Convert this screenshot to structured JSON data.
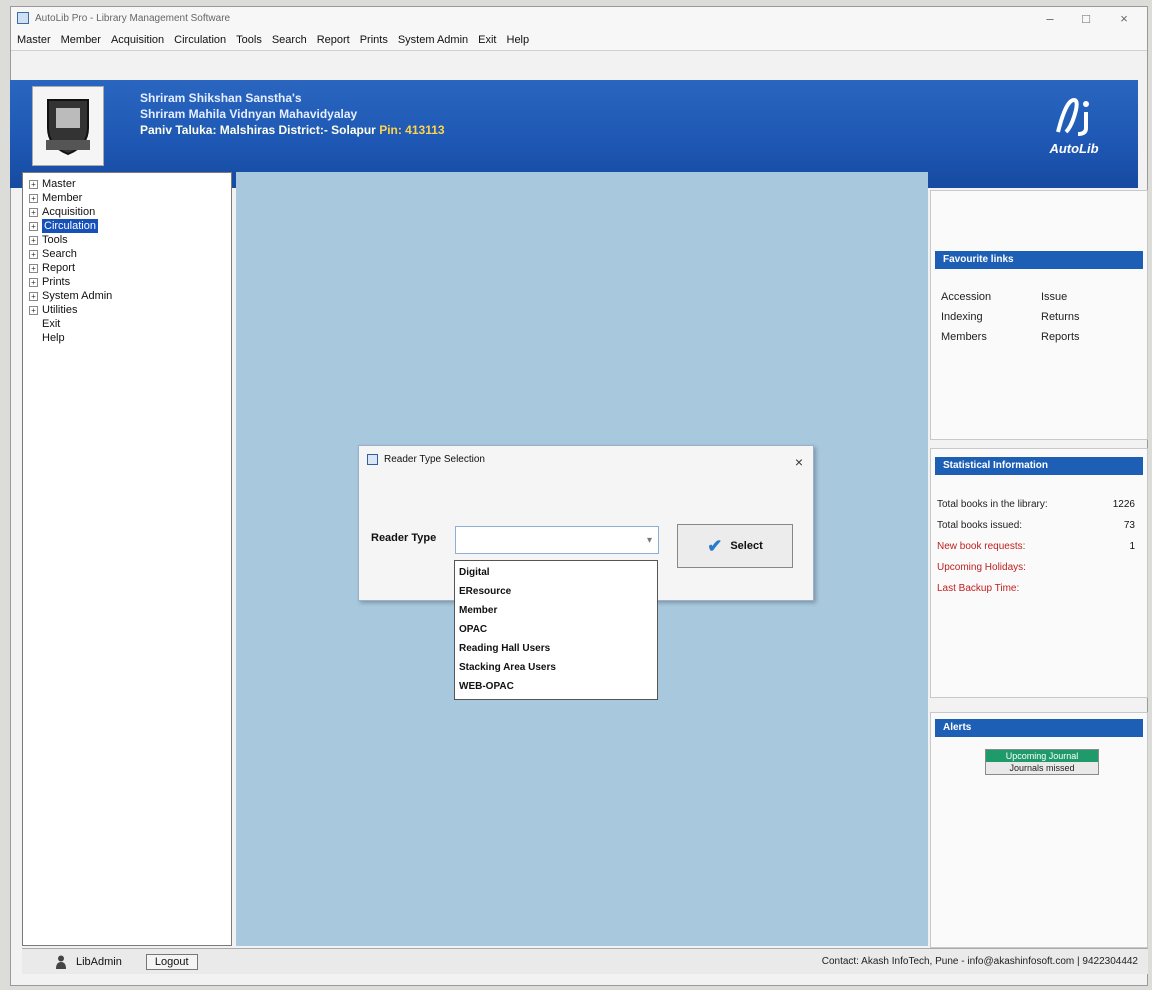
{
  "window": {
    "title": "AutoLib Pro - Library Management Software",
    "controls": [
      "–",
      "□",
      "×"
    ]
  },
  "menubar": {
    "items": [
      "Master",
      "Member",
      "Acquisition",
      "Circulation",
      "Tools",
      "Search",
      "Report",
      "Prints",
      "System Admin",
      "Exit",
      "Help"
    ]
  },
  "banner": {
    "line1": "Shriram Shikshan Sanstha's",
    "line2": "Shriram Mahila Vidnyan Mahavidyalay",
    "line3": "Paniv Taluka: Malshiras  District:- Solapur",
    "pin": "Pin: 413113",
    "brand_text": "AutoLib",
    "brand_color": "#1d57b3"
  },
  "sidebar": {
    "items": [
      {
        "label": "Master",
        "expandable": true
      },
      {
        "label": "Member",
        "expandable": true
      },
      {
        "label": "Acquisition",
        "expandable": true
      },
      {
        "label": "Circulation",
        "expandable": true,
        "selected": true
      },
      {
        "label": "Tools",
        "expandable": true
      },
      {
        "label": "Search",
        "expandable": true
      },
      {
        "label": "Report",
        "expandable": true
      },
      {
        "label": "Prints",
        "expandable": true
      },
      {
        "label": "System Admin",
        "expandable": true
      },
      {
        "label": "Utilities",
        "expandable": true
      },
      {
        "label": "Exit",
        "expandable": false
      },
      {
        "label": "Help",
        "expandable": false
      }
    ]
  },
  "favorites": {
    "header": "Favourite links",
    "links": [
      "Accession",
      "Issue",
      "Indexing",
      "Returns",
      "Members",
      "Reports"
    ]
  },
  "statistics": {
    "header": "Statistical Information",
    "rows": [
      {
        "label": "Total books in the library:",
        "value": "1226",
        "red": false
      },
      {
        "label": "Total books issued:",
        "value": "73",
        "red": false
      },
      {
        "label": "New book requests:",
        "value": "1",
        "red": true
      },
      {
        "label": "Upcoming Holidays:",
        "value": "",
        "red": true
      },
      {
        "label": "Last Backup Time:",
        "value": "",
        "red": true
      }
    ]
  },
  "alerts": {
    "header": "Alerts",
    "tab_active": "Upcoming Journal",
    "tab_inactive": "Journals missed"
  },
  "dialog": {
    "title": "Reader Type Selection",
    "close": "×",
    "reader_type_label": "Reader Type",
    "combo_value": "",
    "select_label": "Select",
    "options": [
      "Digital",
      "EResource",
      "Member",
      "OPAC",
      "Reading Hall Users",
      "Stacking Area Users",
      "WEB-OPAC"
    ]
  },
  "statusbar": {
    "user": "LibAdmin",
    "logout": "Logout",
    "contact": "Contact: Akash InfoTech, Pune - info@akashinfosoft.com | 9422304442"
  }
}
